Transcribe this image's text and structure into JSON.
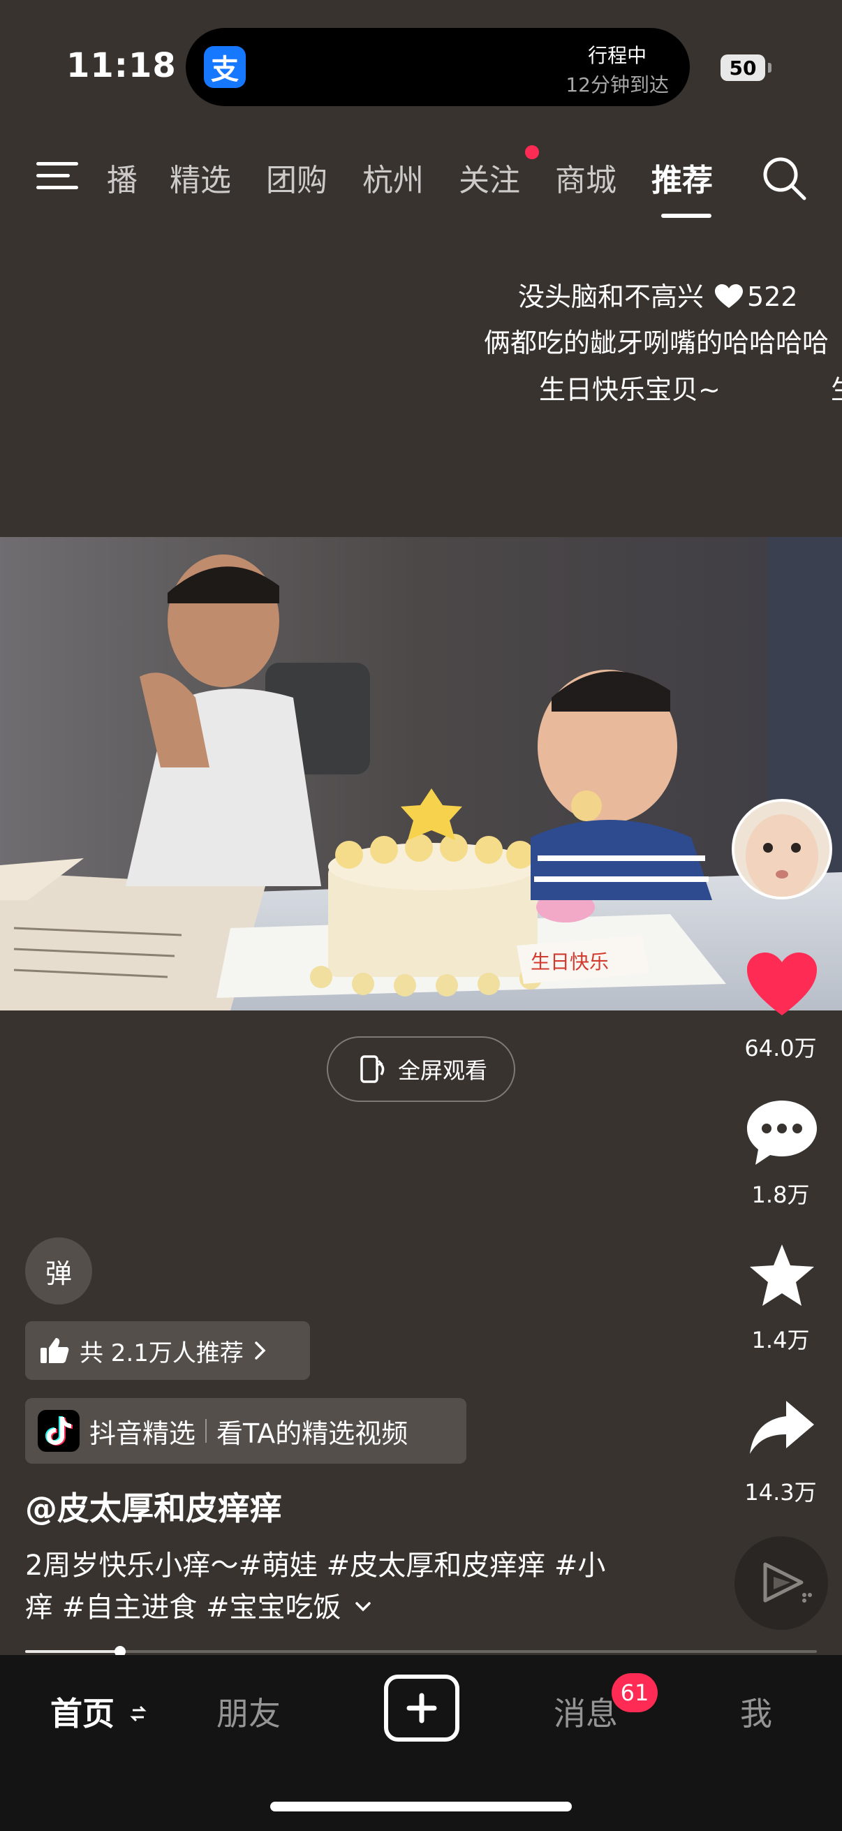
{
  "status_bar": {
    "time": "11:18",
    "island_status_line1": "行程中",
    "island_status_line2": "12分钟到达",
    "island_app_icon": "支",
    "battery": "50"
  },
  "top_nav": {
    "tabs": [
      "播",
      "精选",
      "团购",
      "杭州",
      "关注",
      "商城",
      "推荐"
    ],
    "active_tab": "推荐"
  },
  "danmaku": {
    "line1_text": "没头脑和不高兴",
    "line1_likes": "522",
    "line2_text": "俩都吃的龇牙咧嘴的哈哈哈哈",
    "line3_text": "生日快乐宝贝~",
    "line3_trailing": "生"
  },
  "video": {
    "cake_sign_text": "生日快乐"
  },
  "fullscreen_button": {
    "label": "全屏观看"
  },
  "right_rail": {
    "likes": "64.0万",
    "comments": "1.8万",
    "favorites": "1.4万",
    "shares": "14.3万"
  },
  "info": {
    "danmu_toggle": "弹",
    "recommend_label": "共 2.1万人推荐",
    "jingxuan_label": "抖音精选",
    "jingxuan_link": "看TA的精选视频",
    "author": "@皮太厚和皮痒痒",
    "description_line1": "2周岁快乐小痒～#萌娃 #皮太厚和皮痒痒 #小",
    "description_line2": "痒 #自主进食 #宝宝吃饭",
    "progress": 0.12
  },
  "tab_bar": {
    "home": "首页",
    "friends": "朋友",
    "messages": "消息",
    "messages_badge": "61",
    "me": "我"
  },
  "colors": {
    "background": "#38332e",
    "accent_red": "#fe2c55",
    "alipay_blue": "#1677ff",
    "tabbar": "#141414"
  }
}
